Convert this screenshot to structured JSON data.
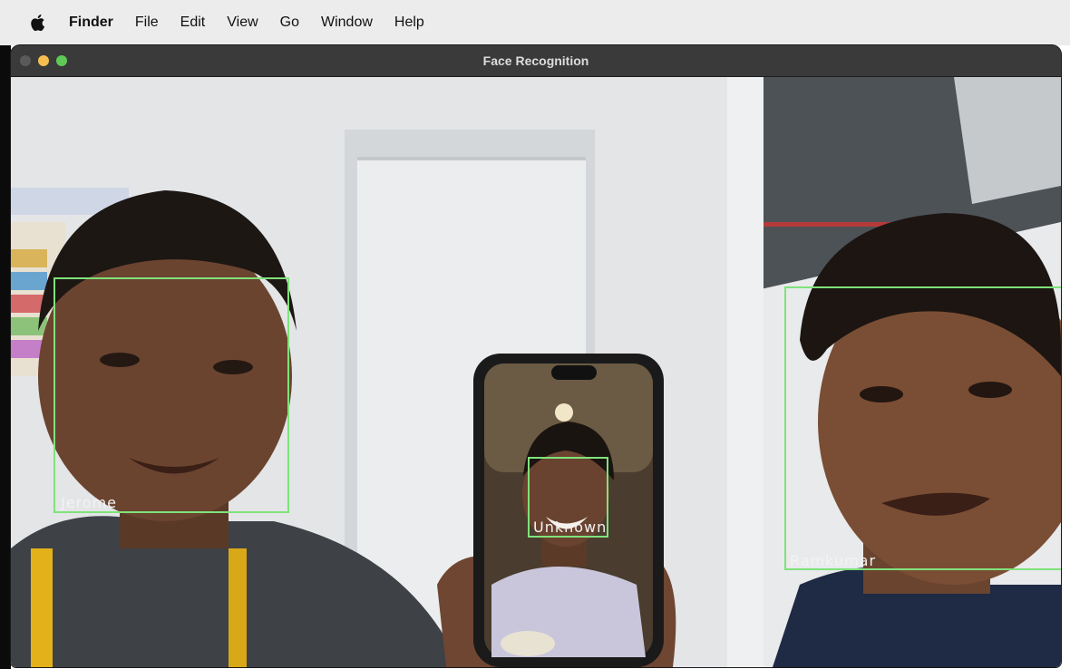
{
  "menubar": {
    "apple_icon": "apple-logo-icon",
    "app_name": "Finder",
    "items": [
      "File",
      "Edit",
      "View",
      "Go",
      "Window",
      "Help"
    ]
  },
  "window": {
    "title": "Face Recognition",
    "traffic_lights": [
      "close",
      "minimize",
      "maximize"
    ]
  },
  "detections": [
    {
      "label": "Jerome",
      "color": "#7fe27a"
    },
    {
      "label": "Unknown",
      "color": "#7fe27a"
    },
    {
      "label": "Ramkumar",
      "color": "#7fe27a"
    }
  ]
}
